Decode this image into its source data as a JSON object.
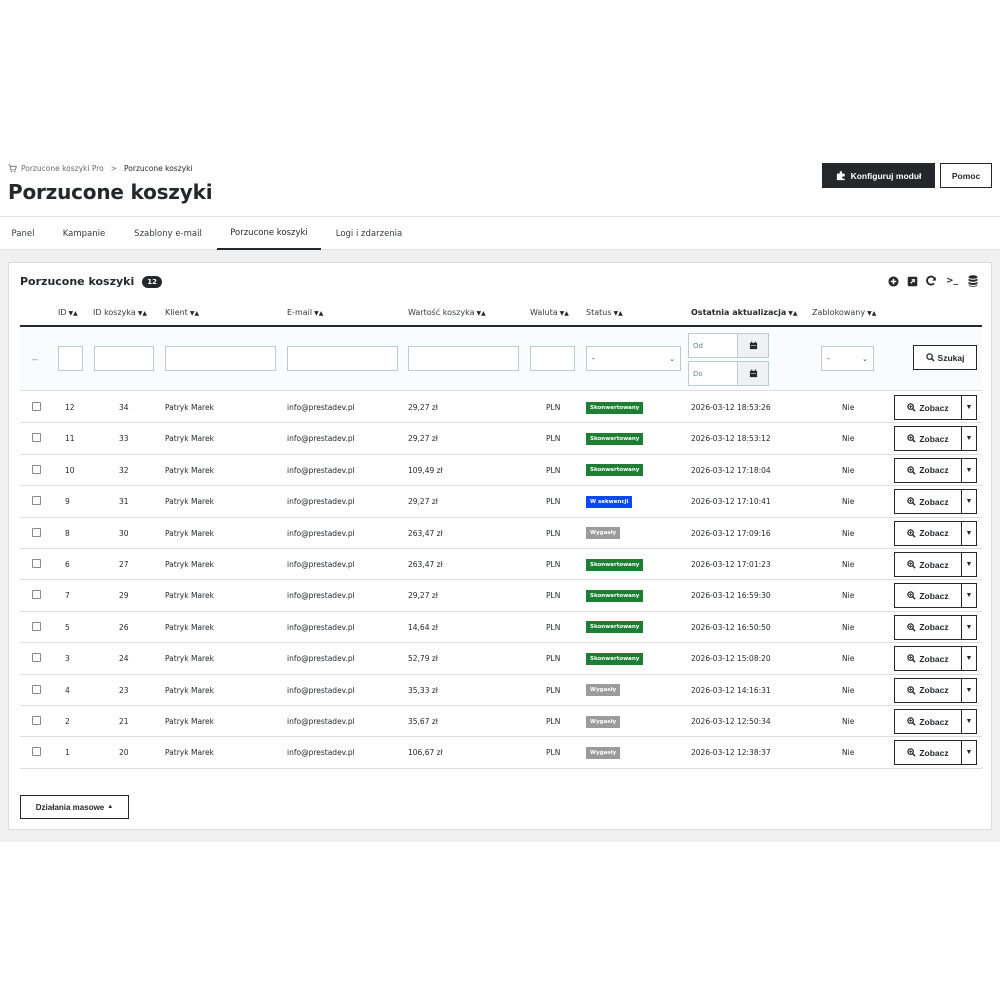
{
  "breadcrumb": {
    "parent": "Porzucone koszyki Pro",
    "separator": ">",
    "current": "Porzucone koszyki"
  },
  "page_title": "Porzucone koszyki",
  "header_buttons": {
    "configure": "Konfiguruj moduł",
    "help": "Pomoc"
  },
  "tabs": [
    {
      "label": "Panel"
    },
    {
      "label": "Kampanie"
    },
    {
      "label": "Szablony e-mail"
    },
    {
      "label": "Porzucone koszyki",
      "active": true
    },
    {
      "label": "Logi i zdarzenia"
    }
  ],
  "panel": {
    "title": "Porzucone koszyki",
    "count": "12",
    "tool_icons": [
      "add-icon",
      "export-icon",
      "refresh-icon",
      "sql-terminal-icon",
      "database-icon"
    ]
  },
  "table": {
    "headers": {
      "id": "ID",
      "cart_id": "ID koszyka",
      "customer": "Klient",
      "email": "E-mail",
      "cart_value": "Wartość koszyka",
      "currency": "Waluta",
      "status": "Status",
      "last_update": "Ostatnia aktualizacja",
      "blocked": "Zablokowany"
    },
    "filters": {
      "empty_marker": "--",
      "status_select": "-",
      "date_from_placeholder": "Od",
      "date_to_placeholder": "Do",
      "blocked_select": "-",
      "search_button": "Szukaj"
    },
    "view_button": "Zobacz",
    "rows": [
      {
        "id": "12",
        "cart_id": "34",
        "customer": "Patryk Marek",
        "email": "info@prestadev.pl",
        "value": "29,27 zł",
        "currency": "PLN",
        "status": "Skonwertowany",
        "status_color": "#1e7e34",
        "updated": "2026-03-12 18:53:26",
        "blocked": "Nie"
      },
      {
        "id": "11",
        "cart_id": "33",
        "customer": "Patryk Marek",
        "email": "info@prestadev.pl",
        "value": "29,27 zł",
        "currency": "PLN",
        "status": "Skonwertowany",
        "status_color": "#1e7e34",
        "updated": "2026-03-12 18:53:12",
        "blocked": "Nie"
      },
      {
        "id": "10",
        "cart_id": "32",
        "customer": "Patryk Marek",
        "email": "info@prestadev.pl",
        "value": "109,49 zł",
        "currency": "PLN",
        "status": "Skonwertowany",
        "status_color": "#1e7e34",
        "updated": "2026-03-12 17:18:04",
        "blocked": "Nie"
      },
      {
        "id": "9",
        "cart_id": "31",
        "customer": "Patryk Marek",
        "email": "info@prestadev.pl",
        "value": "29,27 zł",
        "currency": "PLN",
        "status": "W sekwencji",
        "status_color": "#0d47f0",
        "updated": "2026-03-12 17:10:41",
        "blocked": "Nie"
      },
      {
        "id": "8",
        "cart_id": "30",
        "customer": "Patryk Marek",
        "email": "info@prestadev.pl",
        "value": "263,47 zł",
        "currency": "PLN",
        "status": "Wygasły",
        "status_color": "#9b9b9b",
        "updated": "2026-03-12 17:09:16",
        "blocked": "Nie"
      },
      {
        "id": "6",
        "cart_id": "27",
        "customer": "Patryk Marek",
        "email": "info@prestadev.pl",
        "value": "263,47 zł",
        "currency": "PLN",
        "status": "Skonwertowany",
        "status_color": "#1e7e34",
        "updated": "2026-03-12 17:01:23",
        "blocked": "Nie"
      },
      {
        "id": "7",
        "cart_id": "29",
        "customer": "Patryk Marek",
        "email": "info@prestadev.pl",
        "value": "29,27 zł",
        "currency": "PLN",
        "status": "Skonwertowany",
        "status_color": "#1e7e34",
        "updated": "2026-03-12 16:59:30",
        "blocked": "Nie"
      },
      {
        "id": "5",
        "cart_id": "26",
        "customer": "Patryk Marek",
        "email": "info@prestadev.pl",
        "value": "14,64 zł",
        "currency": "PLN",
        "status": "Skonwertowany",
        "status_color": "#1e7e34",
        "updated": "2026-03-12 16:50:50",
        "blocked": "Nie"
      },
      {
        "id": "3",
        "cart_id": "24",
        "customer": "Patryk Marek",
        "email": "info@prestadev.pl",
        "value": "52,79 zł",
        "currency": "PLN",
        "status": "Skonwertowany",
        "status_color": "#1e7e34",
        "updated": "2026-03-12 15:08:20",
        "blocked": "Nie"
      },
      {
        "id": "4",
        "cart_id": "23",
        "customer": "Patryk Marek",
        "email": "info@prestadev.pl",
        "value": "35,33 zł",
        "currency": "PLN",
        "status": "Wygasły",
        "status_color": "#9b9b9b",
        "updated": "2026-03-12 14:16:31",
        "blocked": "Nie"
      },
      {
        "id": "2",
        "cart_id": "21",
        "customer": "Patryk Marek",
        "email": "info@prestadev.pl",
        "value": "35,67 zł",
        "currency": "PLN",
        "status": "Wygasły",
        "status_color": "#9b9b9b",
        "updated": "2026-03-12 12:50:34",
        "blocked": "Nie"
      },
      {
        "id": "1",
        "cart_id": "20",
        "customer": "Patryk Marek",
        "email": "info@prestadev.pl",
        "value": "106,67 zł",
        "currency": "PLN",
        "status": "Wygasły",
        "status_color": "#9b9b9b",
        "updated": "2026-03-12 12:38:37",
        "blocked": "Nie"
      }
    ]
  },
  "bulk_actions": "Działania masowe"
}
